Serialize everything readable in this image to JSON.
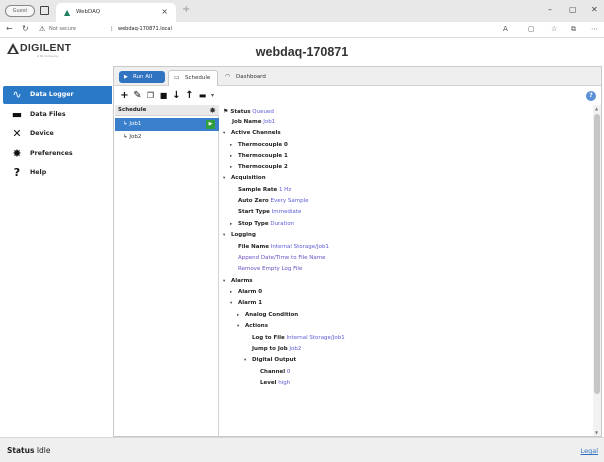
{
  "browser": {
    "profile_label": "Guest",
    "tab_title": "WebDAQ",
    "tab_close": "×",
    "new_tab": "+",
    "security_label": "Not secure",
    "url": "webdaq-170871.local",
    "window_buttons": [
      "–",
      "▢",
      "✕"
    ]
  },
  "app": {
    "logo_text": "DIGILENT",
    "logo_tagline": "A NI Company",
    "hostname": "webdaq-170871"
  },
  "sidebar": {
    "items": [
      {
        "label": "Data Logger",
        "icon": "waveform-icon",
        "active": true
      },
      {
        "label": "Data Files",
        "icon": "folder-icon",
        "active": false
      },
      {
        "label": "Device",
        "icon": "tools-icon",
        "active": false
      },
      {
        "label": "Preferences",
        "icon": "gear-icon",
        "active": false
      },
      {
        "label": "Help",
        "icon": "question-icon",
        "active": false
      }
    ]
  },
  "tabs": {
    "run_all": "Run All",
    "schedule": "Schedule",
    "dashboard": "Dashboard",
    "active": "Schedule"
  },
  "schedule": {
    "header": "Schedule",
    "jobs": [
      {
        "name": "Job1",
        "selected": true
      },
      {
        "name": "Job2",
        "selected": false
      }
    ]
  },
  "details": {
    "status_key": "Status",
    "status_value": "Queued",
    "job_name_key": "Job Name",
    "job_name_value": "Job1",
    "active_channels": "Active Channels",
    "thermocouple0": "Thermocouple 0",
    "thermocouple1": "Thermocouple 1",
    "thermocouple2": "Thermocouple 2",
    "acquisition": "Acquisition",
    "sample_rate_key": "Sample Rate",
    "sample_rate_value": "1 Hz",
    "auto_zero_key": "Auto Zero",
    "auto_zero_value": "Every Sample",
    "start_type_key": "Start Type",
    "start_type_value": "Immediate",
    "stop_type_key": "Stop Type",
    "stop_type_value": "Duration",
    "logging": "Logging",
    "file_name_key": "File Name",
    "file_name_value": "Internal Storage/Job1",
    "append_datetime": "Append Date/Time to File Name",
    "remove_empty": "Remove Empty Log File",
    "alarms": "Alarms",
    "alarm0": "Alarm 0",
    "alarm1": "Alarm 1",
    "analog_condition": "Analog Condition",
    "actions": "Actions",
    "log_to_file_key": "Log to File",
    "log_to_file_value": "Internal Storage/Job1",
    "jump_to_job_key": "Jump to Job",
    "jump_to_job_value": "Job2",
    "digital_output": "Digital Output",
    "channel_key": "Channel",
    "channel_value": "0",
    "level_key": "Level",
    "level_value": "high"
  },
  "footer": {
    "status_key": "Status",
    "status_value": "Idle",
    "legal": "Legal"
  },
  "colors": {
    "accent": "#2979c7",
    "run_button": "#2f73c1",
    "value_text": "#5b5bd6",
    "run_indicator": "#2e9e3e"
  }
}
